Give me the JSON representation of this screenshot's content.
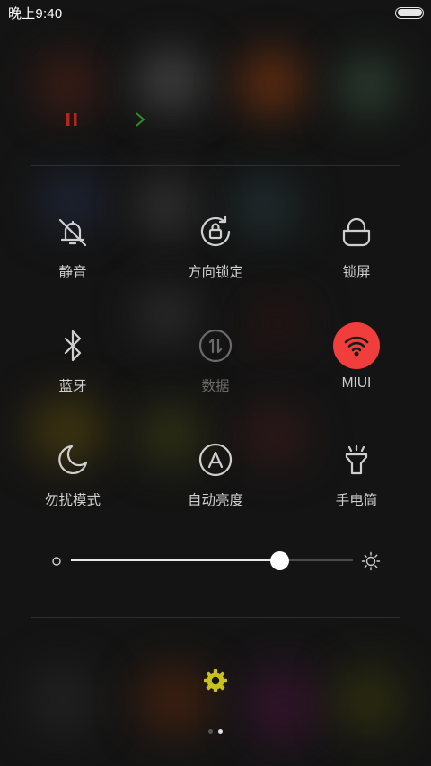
{
  "status_bar": {
    "time": "晚上9:40",
    "battery_level": 1.0
  },
  "media_controls": {
    "pause_icon": "pause-icon",
    "next_icon": "chevron-right-icon",
    "pause_color": "#b3261e",
    "next_color": "#2e8b2e"
  },
  "toggles": [
    {
      "label": "静音",
      "icon": "bell-off-icon",
      "state": "off"
    },
    {
      "label": "方向锁定",
      "icon": "rotation-lock-icon",
      "state": "off"
    },
    {
      "label": "锁屏",
      "icon": "lock-icon",
      "state": "off"
    },
    {
      "label": "蓝牙",
      "icon": "bluetooth-icon",
      "state": "off"
    },
    {
      "label": "数据",
      "icon": "mobile-data-icon",
      "state": "disabled"
    },
    {
      "label": "MIUI",
      "icon": "wifi-icon",
      "state": "on"
    },
    {
      "label": "勿扰模式",
      "icon": "moon-icon",
      "state": "off"
    },
    {
      "label": "自动亮度",
      "icon": "auto-brightness-icon",
      "state": "off"
    },
    {
      "label": "手电筒",
      "icon": "flashlight-icon",
      "state": "off"
    }
  ],
  "brightness": {
    "level": 0.74,
    "min_icon": "brightness-low-icon",
    "max_icon": "sun-icon"
  },
  "settings": {
    "icon": "gear-icon",
    "color": "#c8c01e"
  },
  "pager": {
    "pages": 2,
    "current": 2
  },
  "colors": {
    "active_toggle": "#f13d3b",
    "background": "#141414"
  }
}
